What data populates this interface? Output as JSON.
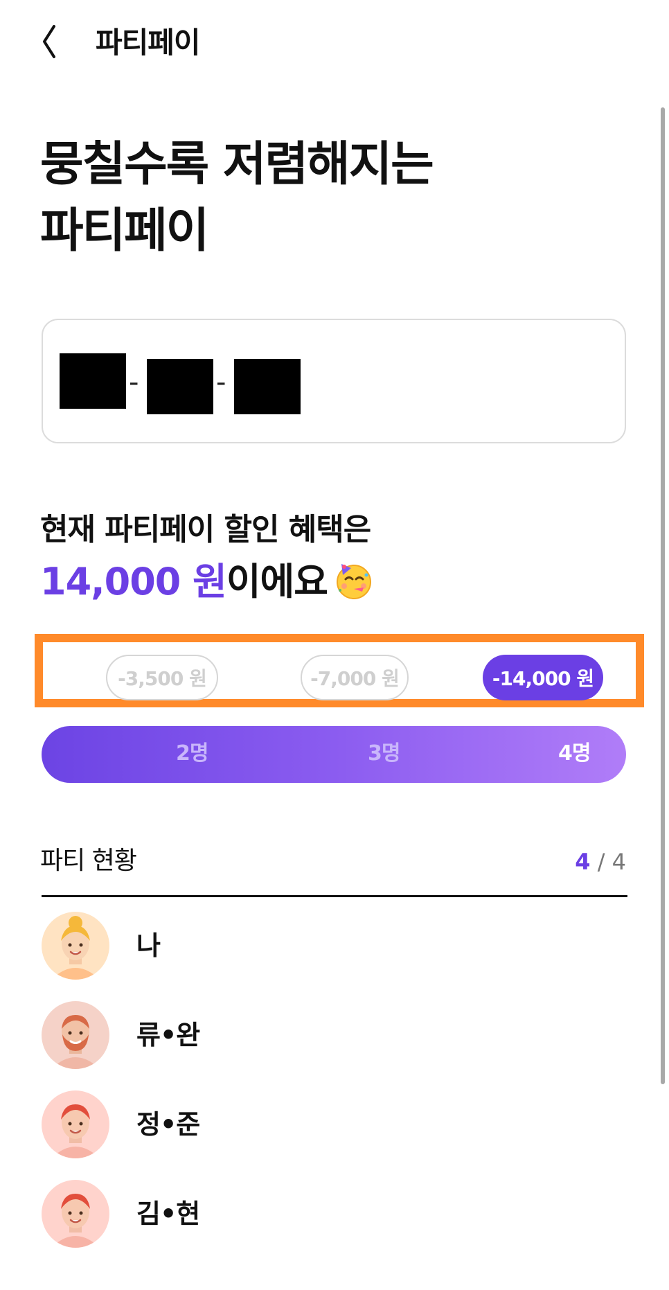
{
  "header": {
    "title": "파티페이",
    "back_icon": "chevron-left-icon"
  },
  "headline": {
    "line1": "뭉칠수록 저렴해지는",
    "line2": "파티페이"
  },
  "code_input": {
    "value_redacted": true,
    "separator": "-"
  },
  "benefit": {
    "line1": "현재 파티페이 할인 혜택은",
    "amount": "14,000 원",
    "suffix": "이에요",
    "emoji_icon": "partying-face-icon"
  },
  "discount_tiers": [
    {
      "label": "-3,500 원",
      "active": false
    },
    {
      "label": "-7,000 원",
      "active": false
    },
    {
      "label": "-14,000 원",
      "active": true
    }
  ],
  "member_steps": [
    {
      "label": "2명",
      "active": false
    },
    {
      "label": "3명",
      "active": false
    },
    {
      "label": "4명",
      "active": true
    }
  ],
  "party": {
    "title": "파티 현황",
    "count_current": "4",
    "count_total": "/ 4",
    "members": [
      {
        "name": "나",
        "avatar": "avatar-blonde-bun"
      },
      {
        "name": "류•완",
        "avatar": "avatar-bearded"
      },
      {
        "name": "정•준",
        "avatar": "avatar-redhead"
      },
      {
        "name": "김•현",
        "avatar": "avatar-redhead"
      }
    ]
  },
  "colors": {
    "accent": "#6b3fe4",
    "highlight": "#ff8a2a",
    "bar_start": "#6c44e4",
    "bar_end": "#b07df8"
  }
}
